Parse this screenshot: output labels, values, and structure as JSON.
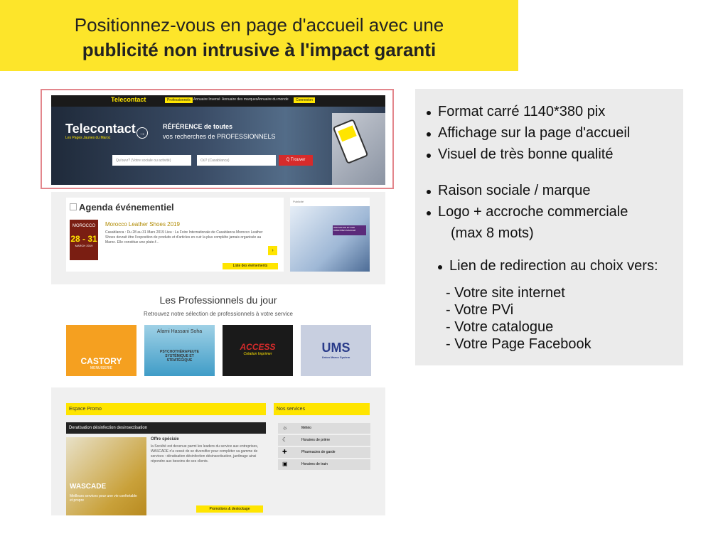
{
  "banner": {
    "line1": "Positionnez-vous en page d'accueil avec une",
    "line2": "publicité non intrusive à l'impact garanti"
  },
  "info": {
    "group1": [
      "Format carré 1140*380 pix",
      "Affichage sur la page d'accueil",
      "Visuel de très bonne qualité"
    ],
    "group2": [
      "Raison sociale / marque",
      "Logo + accroche commerciale"
    ],
    "group2_extra": "(max 8 mots)",
    "group3": "Lien de redirection au choix vers:",
    "links": [
      "- Votre site internet",
      "- Votre PVi",
      "- Votre catalogue",
      "- Votre Page Facebook"
    ]
  },
  "mock": {
    "logo_small": "Telecontact",
    "nav": [
      "Professionnels",
      "Annuaire Inversé",
      "Annuaire des marques",
      "Annuaire du monde",
      "Connexion"
    ],
    "hero_logo": "Telecontact",
    "hero_logo_sub": "Les Pages Jaunes du Maroc",
    "hero_title": "RÉFÉRENCE de toutes",
    "hero_subtitle": "vos recherches de PROFESSIONNELS",
    "search_what": "Qu'ouvr? (Votre sociale ou activité)",
    "search_where": "Où? (Casablanca)",
    "search_button": "Q Trouver",
    "agenda_title": "Agenda événementiel",
    "agenda_event_title": "Morocco Leather Shoes 2019",
    "agenda_event_text": "Casablanca : Du 28 au 31 Mars 2019 Lieu : La Foire Internationale de Casablanca Morocco Leather Shoes devrait être l'exposition de produits et d'articles en cuir la plus complète jamais organisée au Maroc. Elle constitue une plate-f...",
    "agenda_thumb_top": "MOROCCO",
    "agenda_thumb_dates": "28 - 31",
    "agenda_thumb_month": "MARCH 2019",
    "agenda_link": "Liste des événements",
    "pub_label": "Publicité",
    "pub_caption": "INNOVATION ET R&D ORIENTÉES MARCHÉ",
    "pros_title": "Les Professionnels du jour",
    "pros_subtitle": "Retrouvez notre sélection de professionnels à votre service",
    "pros": [
      {
        "name": "CASTORY",
        "sub": "MENUISERIE"
      },
      {
        "name": "Afami Hassani Soha",
        "sub": "PSYCHOTHÉRAPEUTE SYSTÉMIQUE ET STRATÉGIQUE"
      },
      {
        "name": "ACCESS",
        "sub": "Création Imprimer"
      },
      {
        "name": "UMS",
        "sub": "Union Maroc System"
      }
    ],
    "promo_title": "Espace Promo",
    "promo_bar": "Deratisation désinfection desinsectisation",
    "promo_offer": "Offre spéciale",
    "promo_text": "la Société est devenue parmi les leaders du service aux entreprises, WASCADE n'a cessé de se diversifier pour compléter sa gamme de services : dératisation désinfection désinsectisation, jardinage ainsi répondre aux besoins de ses clients.",
    "promo_brand": "WASCADE",
    "promo_brand_sub": "Meilleurs services pour une vie confortable et propre",
    "promo_button": "Promotions & destockage",
    "services_title": "Nos services",
    "services": [
      "Météo",
      "Horaires de prière",
      "Pharmacies de garde",
      "Horaires de train"
    ]
  },
  "colors": {
    "yellow": "#fde52a",
    "panel": "#ebebeb",
    "frame": "#e3868c",
    "red": "#d62b2b"
  }
}
